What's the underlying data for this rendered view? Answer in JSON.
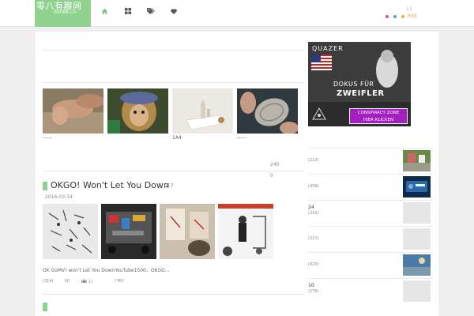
{
  "header": {
    "site_name": "零八有趣网",
    "domain": "d0088.cn",
    "nav": [
      {
        "icon": "home-icon"
      },
      {
        "icon": "grid-icon"
      },
      {
        "icon": "tags-icon"
      },
      {
        "icon": "heart-icon"
      }
    ],
    "top_marks": "| |",
    "rss_label": "RSS",
    "dot_colors": [
      "#e9556b",
      "#5aa0e0",
      "#f0b23a"
    ]
  },
  "thumbs": {
    "items": [
      {
        "caption": "——"
      },
      {
        "caption": ""
      },
      {
        "caption": "1A4"
      },
      {
        "caption": "——"
      }
    ]
  },
  "stats": {
    "count": "240",
    "zero": "0"
  },
  "post": {
    "title": "OKGO! Won't Let You Down",
    "pic_count": "7",
    "date": "2016-03-14",
    "excerpt": "OK GoMV! won't Let You DownYouTube1500、OKGO...",
    "meta": [
      "(314)",
      "(0)",
      "( 1)",
      "/ MV"
    ]
  },
  "sidebar": {
    "ad": {
      "brand": "QUAZER",
      "line1": "DOKUS FÜR",
      "line2": "ZWEIFLER",
      "button_line1": "CONSPIRACY ZONE",
      "button_line2": "HIER KLICKEN"
    },
    "items": [
      {
        "title": "",
        "count": "(212)",
        "has_image": true
      },
      {
        "title": "",
        "count": "(458)",
        "has_image": true
      },
      {
        "title": "24",
        "count": "(210)",
        "has_image": false
      },
      {
        "title": "",
        "count": "(217)",
        "has_image": false
      },
      {
        "title": "",
        "count": "(920)",
        "has_image": true
      },
      {
        "title": "10",
        "count": "(276)",
        "has_image": false
      }
    ]
  }
}
